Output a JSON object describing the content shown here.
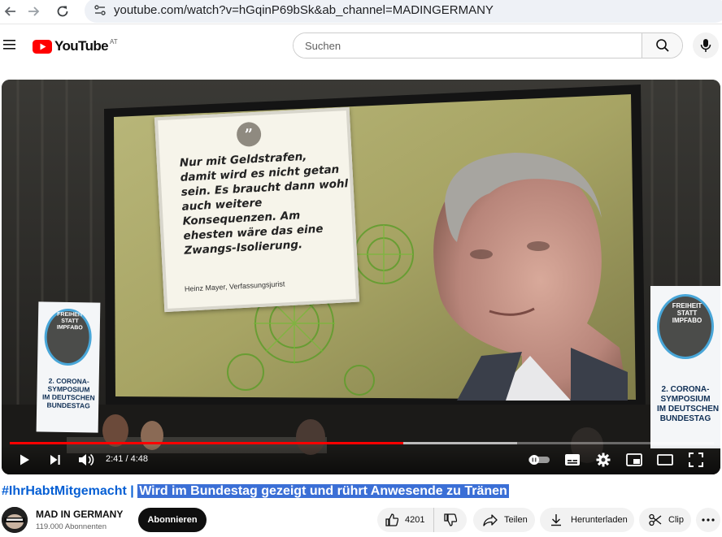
{
  "browser": {
    "url": "youtube.com/watch?v=hGqinP69bSk&ab_channel=MADINGERMANY",
    "icons": {
      "back": "back-arrow-icon",
      "forward": "forward-arrow-icon",
      "reload": "reload-icon",
      "site_info": "site-settings-icon"
    }
  },
  "header": {
    "logo_text": "YouTube",
    "region": "AT",
    "search_placeholder": "Suchen",
    "icons": {
      "menu": "hamburger-menu-icon",
      "search": "search-icon",
      "mic": "microphone-icon"
    }
  },
  "video": {
    "quote_mark": "”",
    "quote_lines": [
      "Nur mit Geldstrafen,",
      "damit wird es nicht getan",
      "sein. Es braucht dann wohl",
      "auch weitere",
      "Konsequenzen. Am",
      "ehesten wäre das eine",
      "Zwangs-Isolierung."
    ],
    "quote_author": "Heinz Mayer, Verfassungsjurist",
    "banner_left": "2. CORONA-\nSYMPOSIUM\nIM DEUTSCHEN\nBUNDESTAG",
    "banner_right": "2. CORONA-\nSYMPOSIUM\nIM DEUTSCHEN\nBUNDESTAG",
    "banner_sign": "FREIHEIT\nSTATT\nIMPFABO",
    "player": {
      "current_time": "2:41",
      "separator": "/",
      "duration": "4:48",
      "progress_fraction": 0.559,
      "buffered_fraction": 0.72,
      "progress_color": "#ff0000"
    }
  },
  "title": {
    "hashtag": "#IhrHabtMitgemacht",
    "separator": "|",
    "text": "Wird im Bundestag gezeigt und rührt Anwesende zu Tränen",
    "hashtag_color": "#065fd4",
    "highlight_color": "#3b6fd6"
  },
  "channel": {
    "name": "MAD IN GERMANY",
    "subscribers": "119.000 Abonnenten",
    "subscribe_label": "Abonnieren"
  },
  "actions": {
    "likes": "4201",
    "share_label": "Teilen",
    "download_label": "Herunterladen",
    "clip_label": "Clip",
    "icons": {
      "like": "thumbs-up-icon",
      "dislike": "thumbs-down-icon",
      "share": "share-icon",
      "download": "download-icon",
      "clip": "scissors-icon",
      "more": "more-horizontal-icon"
    }
  }
}
